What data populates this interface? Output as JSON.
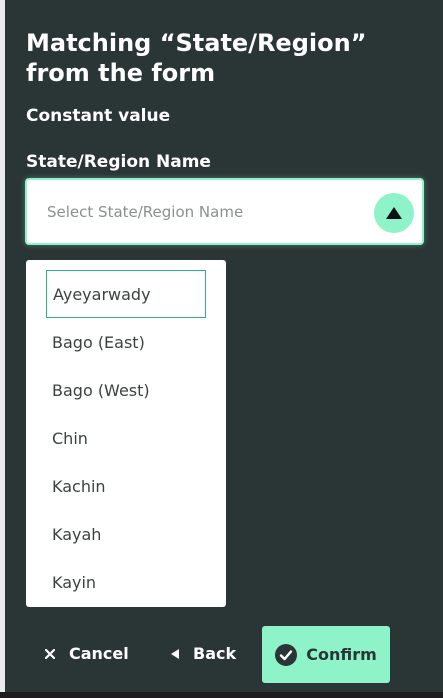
{
  "dialog": {
    "title": "Matching “State/Region” from the form",
    "subtitle": "Constant value"
  },
  "field": {
    "label": "State/Region Name",
    "placeholder": "Select State/Region Name",
    "toggle_icon": "triangle-up-icon"
  },
  "dropdown": {
    "options": [
      {
        "label": "Ayeyarwady"
      },
      {
        "label": "Bago (East)"
      },
      {
        "label": "Bago (West)"
      },
      {
        "label": "Chin"
      },
      {
        "label": "Kachin"
      },
      {
        "label": "Kayah"
      },
      {
        "label": "Kayin"
      }
    ]
  },
  "footer": {
    "cancel_label": "Cancel",
    "back_label": "Back",
    "confirm_label": "Confirm"
  },
  "colors": {
    "background": "#2a3536",
    "accent": "#8ff3c9",
    "active_border": "#2fb08a"
  }
}
